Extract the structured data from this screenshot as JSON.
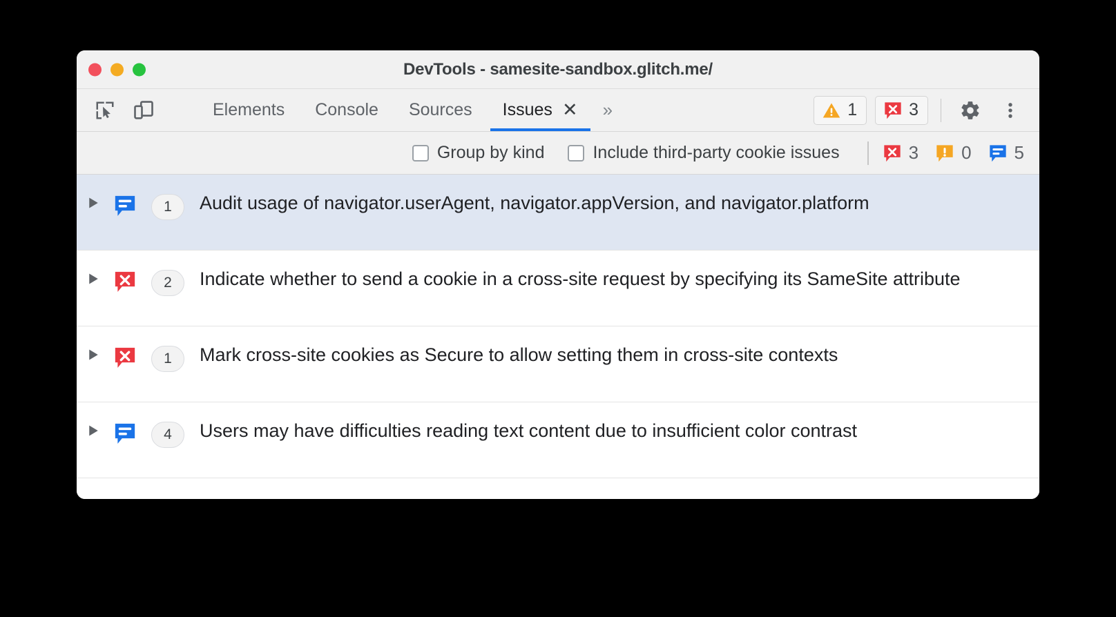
{
  "window": {
    "title": "DevTools - samesite-sandbox.glitch.me/",
    "controls": {
      "close_label": "close",
      "minimize_label": "minimize",
      "maximize_label": "maximize"
    }
  },
  "toolbar": {
    "inspect_icon": "inspect-element-icon",
    "device_icon": "device-toolbar-icon",
    "tabs": [
      {
        "label": "Elements",
        "active": false
      },
      {
        "label": "Console",
        "active": false
      },
      {
        "label": "Sources",
        "active": false
      },
      {
        "label": "Issues",
        "active": true,
        "close": "✕"
      }
    ],
    "overflow_label": "»",
    "warning_count": "1",
    "error_count": "3",
    "settings_icon": "gear-icon",
    "more_icon": "more-options-icon"
  },
  "filterbar": {
    "group_by_kind_label": "Group by kind",
    "group_by_kind_checked": false,
    "third_party_label": "Include third-party cookie issues",
    "third_party_checked": false,
    "counts": {
      "page_errors": "3",
      "warnings": "0",
      "info": "5"
    }
  },
  "issues": [
    {
      "kind": "info",
      "count": "1",
      "title": "Audit usage of navigator.userAgent, navigator.appVersion, and navigator.platform",
      "selected": true
    },
    {
      "kind": "error",
      "count": "2",
      "title": "Indicate whether to send a cookie in a cross-site request by specifying its SameSite attribute",
      "selected": false
    },
    {
      "kind": "error",
      "count": "1",
      "title": "Mark cross-site cookies as Secure to allow setting them in cross-site contexts",
      "selected": false
    },
    {
      "kind": "info",
      "count": "4",
      "title": "Users may have difficulties reading text content due to insufficient color contrast",
      "selected": false
    }
  ],
  "colors": {
    "accent_blue": "#1a73e8",
    "error_red": "#eb3941",
    "warning_orange": "#f5a623",
    "info_blue": "#1a73e8",
    "selected_row": "#dfe6f2",
    "chrome_gray": "#f1f1f1"
  }
}
